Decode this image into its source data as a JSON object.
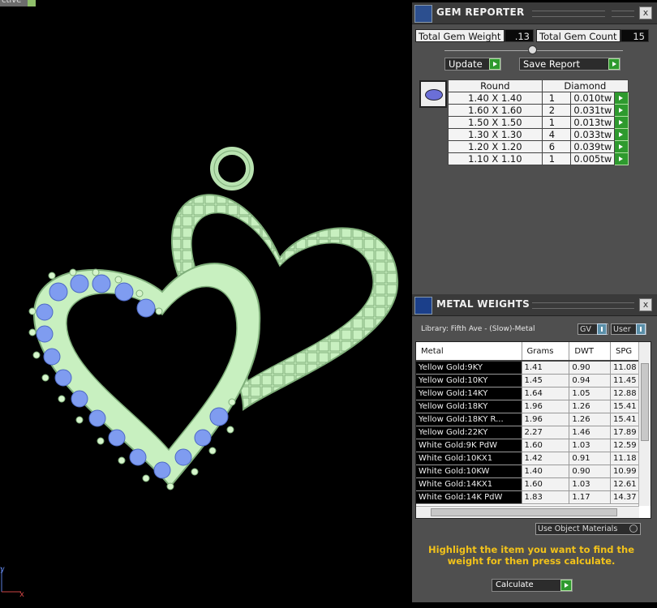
{
  "viewport": {
    "tab_label": "ctive",
    "axis_y": "y",
    "axis_x": "x"
  },
  "gem_reporter": {
    "title": "GEM REPORTER",
    "close": "x",
    "total_gem_weight_label": "Total Gem Weight",
    "total_gem_weight": ".13",
    "total_gem_count_label": "Total Gem Count",
    "total_gem_count": "15",
    "update_label": "Update",
    "save_report_label": "Save Report",
    "columns": [
      "Round",
      "Diamond"
    ],
    "rows": [
      {
        "size": "1.40 X 1.40",
        "qty": "1",
        "weight": "0.010tw"
      },
      {
        "size": "1.60 X 1.60",
        "qty": "2",
        "weight": "0.031tw"
      },
      {
        "size": "1.50 X 1.50",
        "qty": "1",
        "weight": "0.013tw"
      },
      {
        "size": "1.30 X 1.30",
        "qty": "4",
        "weight": "0.033tw"
      },
      {
        "size": "1.20 X 1.20",
        "qty": "6",
        "weight": "0.039tw"
      },
      {
        "size": "1.10 X 1.10",
        "qty": "1",
        "weight": "0.005tw"
      }
    ]
  },
  "metal_weights": {
    "title": "METAL WEIGHTS",
    "close": "x",
    "library_label": "Library: Fifth Ave - (Slow)-Metal",
    "gv_label": "GV",
    "user_label": "User",
    "columns": [
      "Metal",
      "Grams",
      "DWT",
      "SPG"
    ],
    "rows": [
      {
        "metal": "Yellow Gold:9KY",
        "grams": "1.41",
        "dwt": "0.90",
        "spg": "11.08"
      },
      {
        "metal": "Yellow Gold:10KY",
        "grams": "1.45",
        "dwt": "0.94",
        "spg": "11.45"
      },
      {
        "metal": "Yellow Gold:14KY",
        "grams": "1.64",
        "dwt": "1.05",
        "spg": "12.88"
      },
      {
        "metal": "Yellow Gold:18KY",
        "grams": "1.96",
        "dwt": "1.26",
        "spg": "15.41"
      },
      {
        "metal": "Yellow Gold:18KY R...",
        "grams": "1.96",
        "dwt": "1.26",
        "spg": "15.41"
      },
      {
        "metal": "Yellow Gold:22KY",
        "grams": "2.27",
        "dwt": "1.46",
        "spg": "17.89"
      },
      {
        "metal": "White Gold:9K PdW",
        "grams": "1.60",
        "dwt": "1.03",
        "spg": "12.59"
      },
      {
        "metal": "White Gold:10KX1",
        "grams": "1.42",
        "dwt": "0.91",
        "spg": "11.18"
      },
      {
        "metal": "White Gold:10KW",
        "grams": "1.40",
        "dwt": "0.90",
        "spg": "10.99"
      },
      {
        "metal": "White Gold:14KX1",
        "grams": "1.60",
        "dwt": "1.03",
        "spg": "12.61"
      },
      {
        "metal": "White Gold:14K PdW",
        "grams": "1.83",
        "dwt": "1.17",
        "spg": "14.37"
      }
    ],
    "use_object_materials_label": "Use Object Materials",
    "message": "Highlight the item you want to find the weight for then press calculate.",
    "calculate_label": "Calculate"
  },
  "colors": {
    "metal": "#c8f0c0",
    "gem": "#7f9cf0",
    "panel": "#4f4f4f",
    "accent_green": "#2e9a2e",
    "message": "#f2c21a"
  }
}
